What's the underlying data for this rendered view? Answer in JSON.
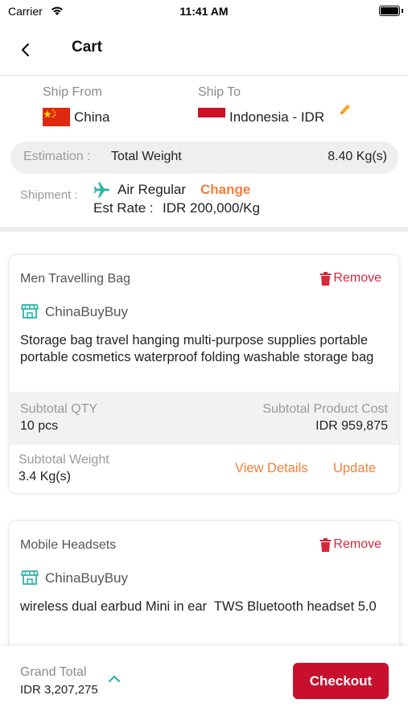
{
  "status_bar": {
    "carrier": "Carrier",
    "time": "11:41 AM"
  },
  "nav": {
    "title": "Cart"
  },
  "shipping": {
    "ship_from_label": "Ship From",
    "ship_from_value": "China",
    "ship_to_label": "Ship To",
    "ship_to_value": "Indonesia - IDR",
    "estimation_label": "Estimation :",
    "total_weight_label": "Total Weight",
    "total_weight_value": "8.40 Kg(s)",
    "shipment_label": "Shipment :",
    "shipment_method": "Air Regular",
    "change_label": "Change",
    "est_rate_label": "Est Rate :",
    "est_rate_value": "IDR 200,000/Kg"
  },
  "cart_items": [
    {
      "name": "Men Travelling Bag",
      "remove_label": "Remove",
      "store": "ChinaBuyBuy",
      "description": "Storage bag travel hanging multi-purpose supplies portable portable cosmetics waterproof folding washable storage bag",
      "subtotal_qty_label": "Subtotal QTY",
      "subtotal_qty_value": "10 pcs",
      "subtotal_cost_label": "Subtotal Product Cost",
      "subtotal_cost_value": "IDR 959,875",
      "subtotal_weight_label": "Subtotal Weight",
      "subtotal_weight_value": "3.4 Kg(s)",
      "view_details_label": "View Details",
      "update_label": "Update"
    },
    {
      "name": "Mobile Headsets",
      "remove_label": "Remove",
      "store": "ChinaBuyBuy",
      "description": "wireless dual earbud Mini in ear  TWS Bluetooth headset 5.0"
    }
  ],
  "footer": {
    "grand_total_label": "Grand Total",
    "grand_total_value": "IDR 3,207,275",
    "checkout_label": "Checkout"
  },
  "colors": {
    "accent_orange": "#f0803c",
    "remove_red": "#d8263a",
    "checkout_red": "#c8102e",
    "teal_icon": "#2bb5a8"
  }
}
